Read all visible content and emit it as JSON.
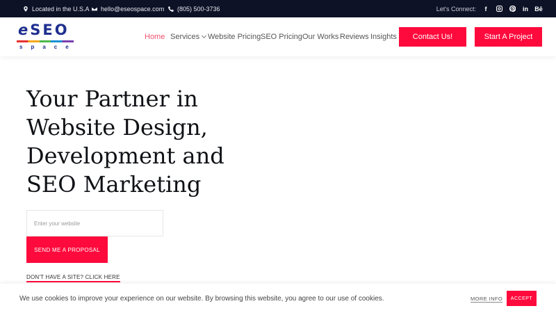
{
  "topbar": {
    "location": "Located in the U.S.A",
    "email": "hello@eseospace.com",
    "phone": "(805) 500-3736",
    "connect_label": "Let's Connect:",
    "social": [
      {
        "icon": "facebook-icon",
        "glyph": "f"
      },
      {
        "icon": "instagram-icon",
        "glyph": ""
      },
      {
        "icon": "pinterest-icon",
        "glyph": ""
      },
      {
        "icon": "linkedin-icon",
        "glyph": "in"
      },
      {
        "icon": "behance-icon",
        "glyph": "Bē"
      }
    ]
  },
  "logo": {
    "word": "SEO",
    "prefix": "e",
    "sub": "space"
  },
  "nav": {
    "items": [
      {
        "label": "Home",
        "active": true
      },
      {
        "label": "Services",
        "has_dropdown": true
      },
      {
        "label": "Website Pricing"
      },
      {
        "label": "SEO Pricing"
      },
      {
        "label": "Our Works"
      },
      {
        "label": "Reviews"
      },
      {
        "label": "Insights"
      }
    ],
    "contact_label": "Contact Us!",
    "project_label": "Start A Project"
  },
  "hero": {
    "title_lines": [
      "Your Partner in",
      "Website Design,",
      "Development and",
      "SEO Marketing"
    ],
    "input_placeholder": "Enter your website",
    "proposal_label": "SEND ME A PROPOSAL",
    "nosite_label": "DON'T HAVE A SITE? CLICK HERE"
  },
  "cookie": {
    "message": "We use cookies to improve your experience on our website. By browsing this website, you agree to our use of cookies.",
    "more_label": "MORE INFO",
    "accept_label": "ACCEPT"
  },
  "colors": {
    "accent": "#ff0a3c",
    "topbar_bg": "#0d1226",
    "nav_active": "#f0506e"
  }
}
